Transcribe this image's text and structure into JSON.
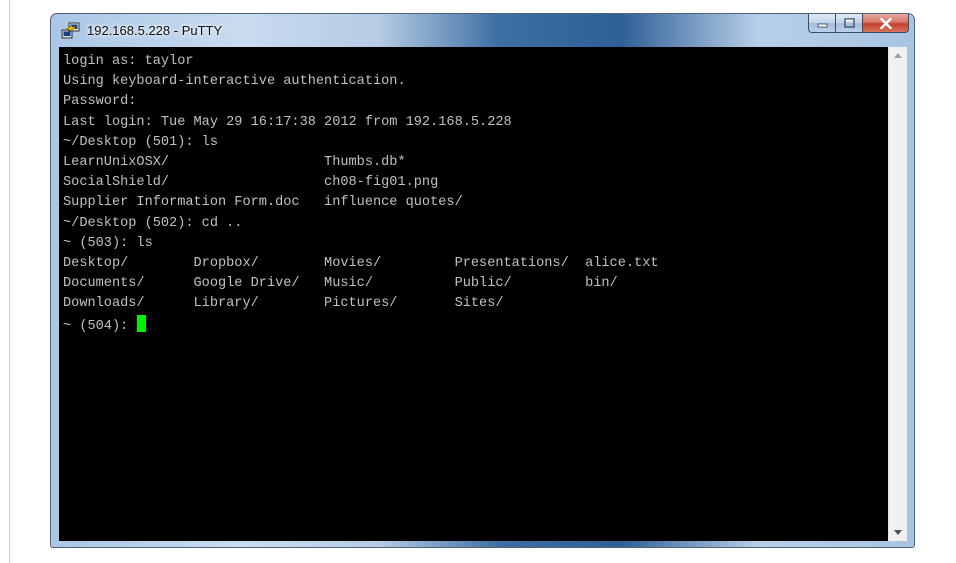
{
  "window": {
    "title": "192.168.5.228 - PuTTY",
    "icon": "putty-icon",
    "caption_buttons": [
      "minimize-icon",
      "maximize-icon",
      "close-icon"
    ]
  },
  "terminal": {
    "lines": [
      "login as: taylor",
      "Using keyboard-interactive authentication.",
      "Password:",
      "Last login: Tue May 29 16:17:38 2012 from 192.168.5.228",
      "~/Desktop (501): ls",
      "LearnUnixOSX/                   Thumbs.db*",
      "SocialShield/                   ch08-fig01.png",
      "Supplier Information Form.doc   influence quotes/",
      "~/Desktop (502): cd ..",
      "~ (503): ls",
      "Desktop/        Dropbox/        Movies/         Presentations/  alice.txt",
      "Documents/      Google Drive/   Music/          Public/         bin/"
    ],
    "line_12": "Downloads/      Library/        Pictures/       Sites/",
    "prompt": "~ (504): "
  },
  "colors": {
    "terminal_bg": "#000000",
    "terminal_fg": "#c0c0c0",
    "cursor": "#00ee00",
    "close_button": "#c2432f"
  }
}
